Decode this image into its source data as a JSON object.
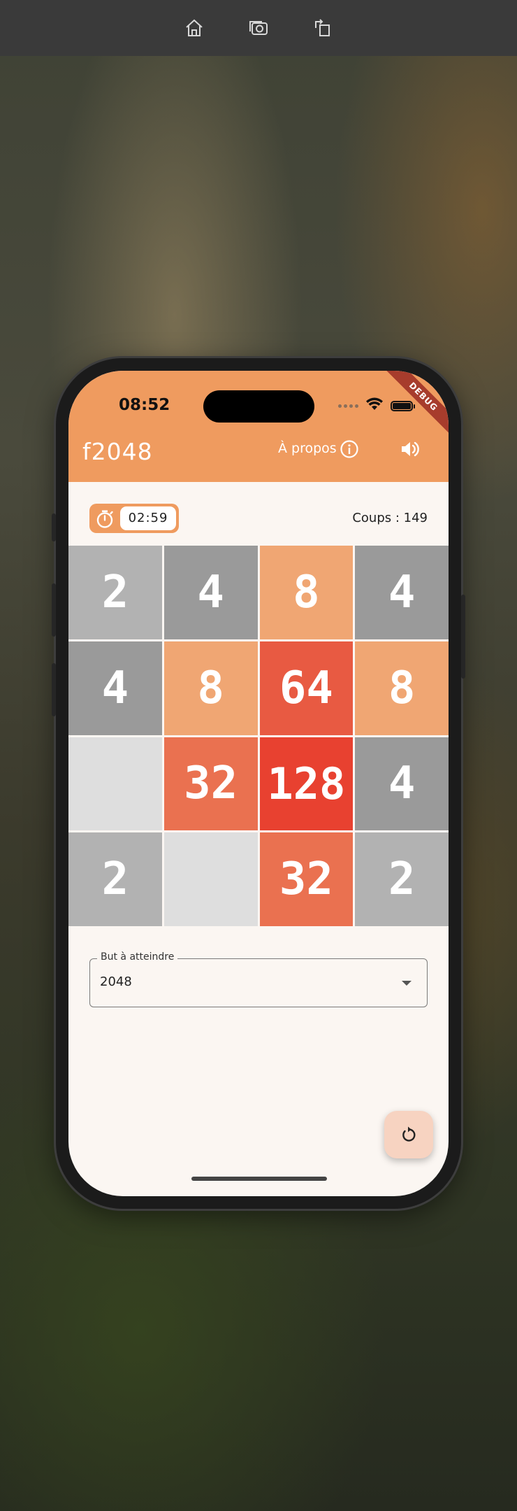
{
  "simulator_toolbar": {
    "icons": [
      "home-icon",
      "screenshot-icon",
      "rotate-icon"
    ]
  },
  "status_bar": {
    "time": "08:52",
    "icons": [
      "signal-dots-icon",
      "wifi-icon",
      "battery-icon"
    ]
  },
  "debug_banner": "DEBUG",
  "app_bar": {
    "title": "f2048",
    "about_label": "À propos",
    "icons": [
      "info-icon",
      "volume-icon"
    ],
    "color": "#ef9b5f"
  },
  "timer": {
    "value": "02:59",
    "icon": "stopwatch-icon"
  },
  "moves": "Coups : 149",
  "board": {
    "rows": [
      [
        "2",
        "4",
        "8",
        "4"
      ],
      [
        "4",
        "8",
        "64",
        "8"
      ],
      [
        "",
        "32",
        "128",
        "4"
      ],
      [
        "2",
        "",
        "32",
        "2"
      ]
    ]
  },
  "goal_select": {
    "label": "But à atteindre",
    "value": "2048"
  },
  "fab": {
    "icon": "restart-icon"
  }
}
